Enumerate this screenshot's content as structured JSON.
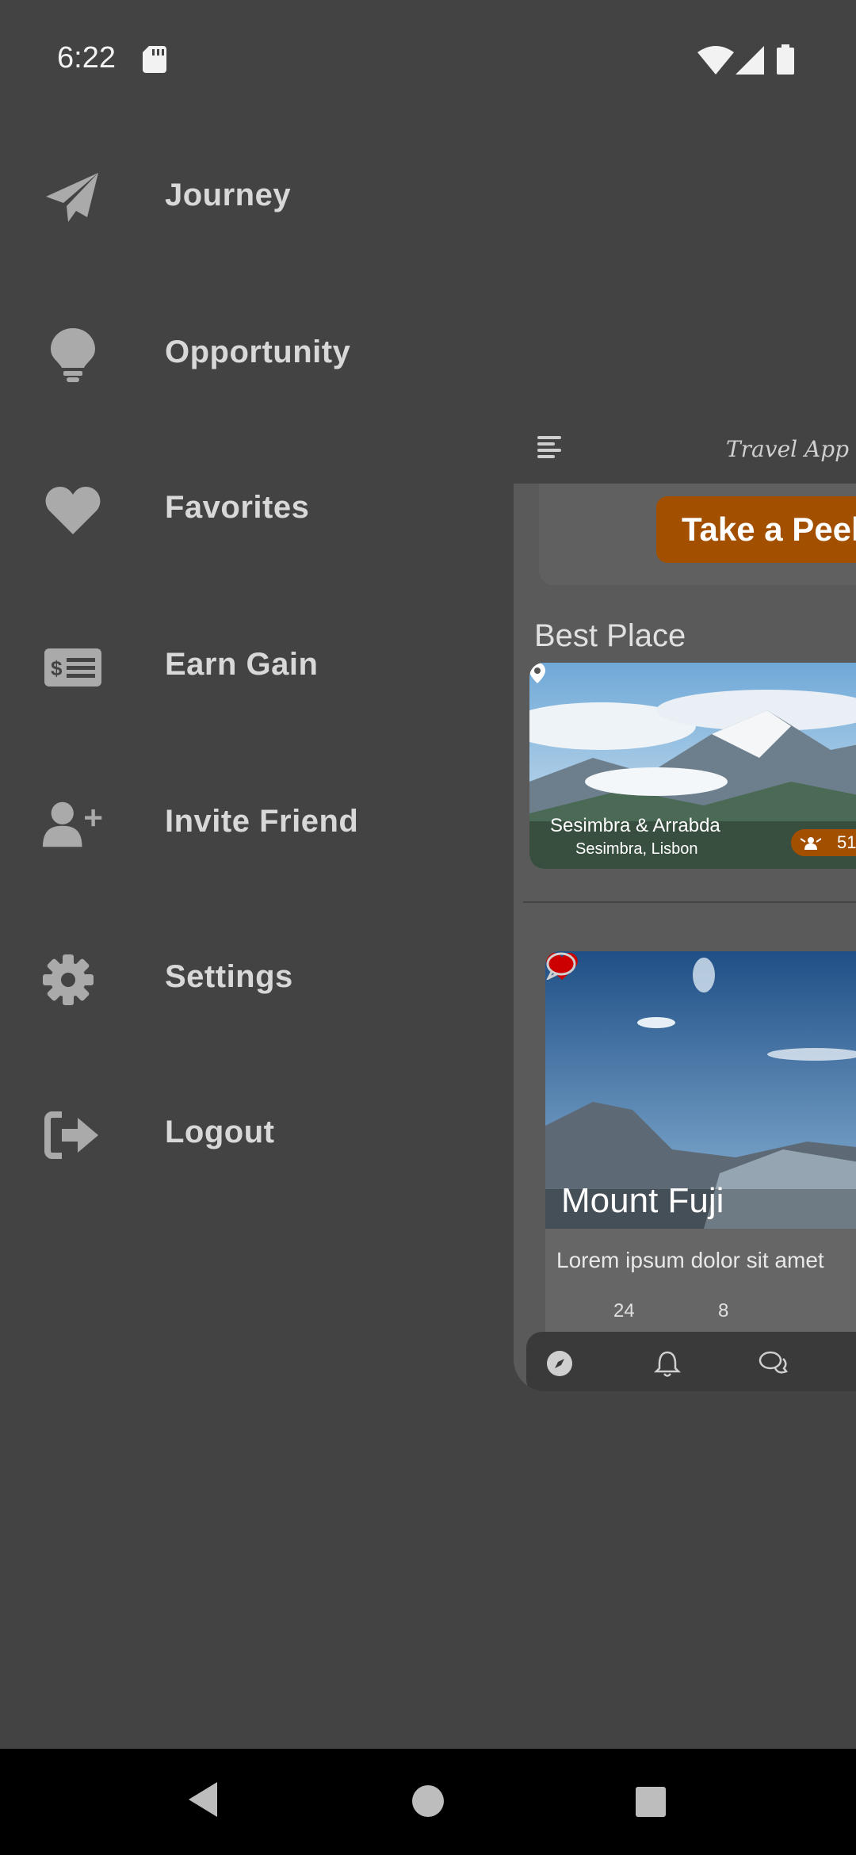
{
  "status_bar": {
    "time": "6:22"
  },
  "drawer": {
    "items": [
      {
        "label": "Journey",
        "icon": "paper-plane-icon"
      },
      {
        "label": "Opportunity",
        "icon": "lightbulb-icon"
      },
      {
        "label": "Favorites",
        "icon": "heart-icon"
      },
      {
        "label": "Earn Gain",
        "icon": "money-card-icon"
      },
      {
        "label": "Invite Friend",
        "icon": "user-plus-icon"
      },
      {
        "label": "Settings",
        "icon": "gear-icon"
      },
      {
        "label": "Logout",
        "icon": "logout-icon"
      }
    ]
  },
  "preview": {
    "app_title": "Travel App",
    "peek_button": "Take a Peek →",
    "section_title": "Best Place",
    "best_place": {
      "name": "Sesimbra & Arrabda",
      "location": "Sesimbra, Lisbon",
      "badge_count": "51"
    },
    "post": {
      "title": "Mount Fuji",
      "text": "Lorem ipsum dolor sit amet",
      "likes": "24",
      "comments": "8"
    }
  },
  "colors": {
    "background": "#434343",
    "accent": "#a24f00",
    "like": "#cc0000"
  }
}
